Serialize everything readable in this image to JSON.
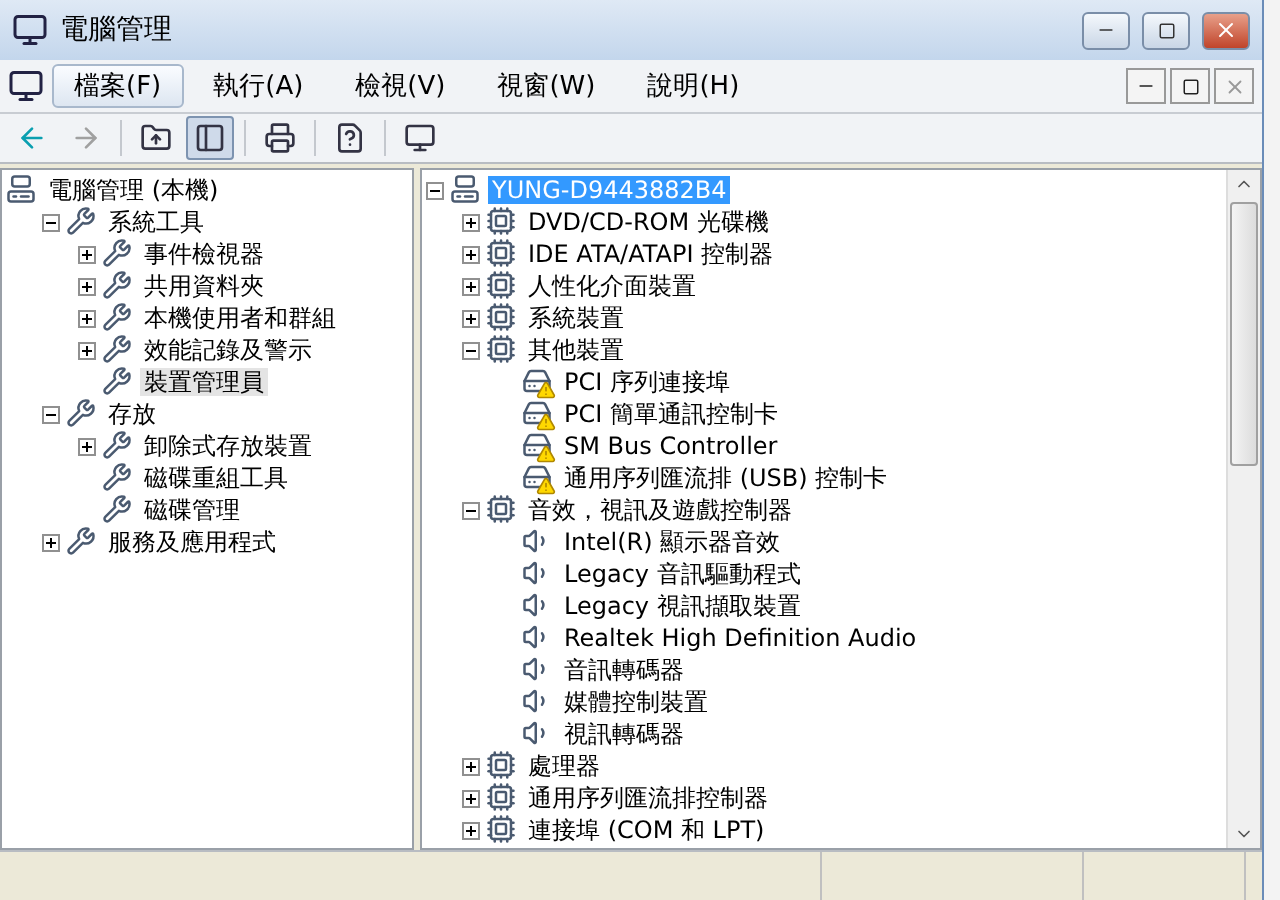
{
  "window": {
    "title": "電腦管理"
  },
  "menu": [
    {
      "label": "檔案(F)",
      "selected": true
    },
    {
      "label": "執行(A)",
      "selected": false
    },
    {
      "label": "檢視(V)",
      "selected": false
    },
    {
      "label": "視窗(W)",
      "selected": false
    },
    {
      "label": "說明(H)",
      "selected": false
    }
  ],
  "toolbar": [
    {
      "kind": "back",
      "disabled": false,
      "on": false
    },
    {
      "kind": "forward",
      "disabled": true,
      "on": false
    },
    {
      "kind": "sep"
    },
    {
      "kind": "up",
      "disabled": false,
      "on": false
    },
    {
      "kind": "tree",
      "disabled": false,
      "on": true
    },
    {
      "kind": "sep"
    },
    {
      "kind": "print",
      "disabled": false,
      "on": false
    },
    {
      "kind": "sep"
    },
    {
      "kind": "help",
      "disabled": false,
      "on": false
    },
    {
      "kind": "sep"
    },
    {
      "kind": "properties",
      "disabled": false,
      "on": false
    }
  ],
  "console_tree": {
    "label": "電腦管理 (本機)",
    "selected": false,
    "children": [
      {
        "label": "系統工具",
        "expanded": true,
        "selected": false,
        "children": [
          {
            "label": "事件檢視器",
            "expanded": false,
            "selected": false
          },
          {
            "label": "共用資料夾",
            "expanded": false,
            "selected": false
          },
          {
            "label": "本機使用者和群組",
            "expanded": false,
            "selected": false
          },
          {
            "label": "效能記錄及警示",
            "expanded": false,
            "selected": false
          },
          {
            "label": "裝置管理員",
            "selected": true
          }
        ]
      },
      {
        "label": "存放",
        "expanded": true,
        "selected": false,
        "children": [
          {
            "label": "卸除式存放裝置",
            "expanded": false,
            "selected": false
          },
          {
            "label": "磁碟重組工具",
            "selected": false
          },
          {
            "label": "磁碟管理",
            "selected": false
          }
        ]
      },
      {
        "label": "服務及應用程式",
        "expanded": false,
        "selected": false
      }
    ]
  },
  "device_tree": {
    "label": "YUNG-D9443882B4",
    "expanded": true,
    "selected": true,
    "children": [
      {
        "label": "DVD/CD-ROM 光碟機",
        "expanded": false,
        "selected": false
      },
      {
        "label": "IDE ATA/ATAPI 控制器",
        "expanded": false,
        "selected": false
      },
      {
        "label": "人性化介面裝置",
        "expanded": false,
        "selected": false
      },
      {
        "label": "系統裝置",
        "expanded": false,
        "selected": false
      },
      {
        "label": "其他裝置",
        "expanded": true,
        "selected": false,
        "children": [
          {
            "label": "PCI 序列連接埠",
            "selected": false,
            "warning": true
          },
          {
            "label": "PCI 簡單通訊控制卡",
            "selected": false,
            "warning": true
          },
          {
            "label": "SM Bus Controller",
            "selected": false,
            "warning": true
          },
          {
            "label": "通用序列匯流排 (USB) 控制卡",
            "selected": false,
            "warning": true
          }
        ]
      },
      {
        "label": "音效，視訊及遊戲控制器",
        "expanded": true,
        "selected": false,
        "children": [
          {
            "label": "Intel(R) 顯示器音效",
            "selected": false
          },
          {
            "label": "Legacy 音訊驅動程式",
            "selected": false
          },
          {
            "label": "Legacy 視訊擷取裝置",
            "selected": false
          },
          {
            "label": "Realtek High Definition Audio",
            "selected": false
          },
          {
            "label": "音訊轉碼器",
            "selected": false
          },
          {
            "label": "媒體控制裝置",
            "selected": false
          },
          {
            "label": "視訊轉碼器",
            "selected": false
          }
        ]
      },
      {
        "label": "處理器",
        "expanded": false,
        "selected": false
      },
      {
        "label": "通用序列匯流排控制器",
        "expanded": false,
        "selected": false
      },
      {
        "label": "連接埠 (COM 和 LPT)",
        "expanded": false,
        "selected": false
      }
    ]
  }
}
